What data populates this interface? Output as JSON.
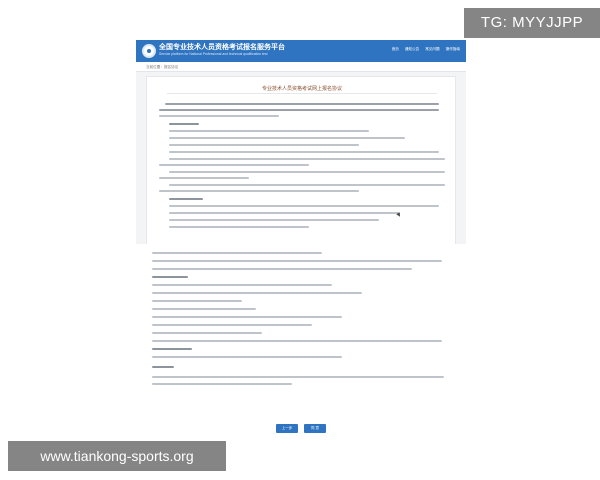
{
  "header": {
    "title": "全国专业技术人员资格考试报名服务平台",
    "subtitle": "Service platform for National Professional and technical qualification test",
    "nav": [
      "首页",
      "通知公告",
      "常见问题",
      "操作指南"
    ]
  },
  "breadcrumb": "当前位置：报名协议",
  "document": {
    "title": "专业技术人员资格考试网上报名协议"
  },
  "buttons": {
    "prev": "上一步",
    "agree": "同 意"
  },
  "watermarks": {
    "top": "TG: MYYJJPP",
    "bottom": "www.tiankong-sports.org"
  },
  "colors": {
    "brand": "#2f74c0",
    "title_accent": "#8a4f2e"
  }
}
